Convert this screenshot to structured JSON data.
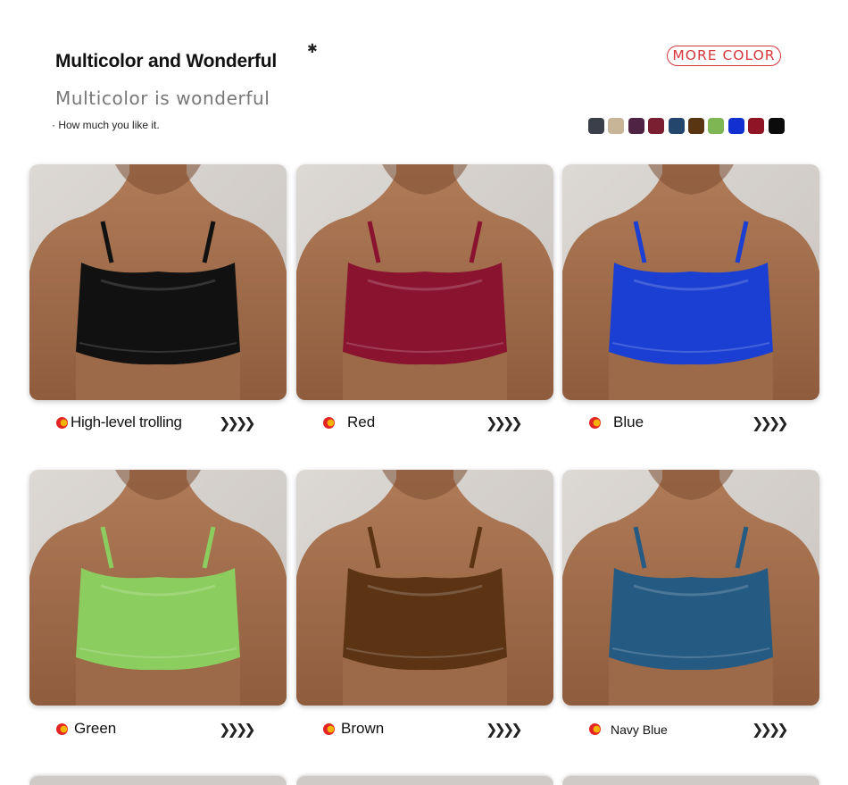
{
  "header": {
    "title": "Multicolor and Wonderful",
    "subtitle": "Multicolor is wonderful",
    "tagline": "· How much you like it.",
    "star_glyph": "✱",
    "more_button": "MORE COLOR"
  },
  "swatches": [
    "#3a3f4a",
    "#c8b597",
    "#4f2343",
    "#7a1f31",
    "#23466d",
    "#5a3512",
    "#7fb654",
    "#1230d0",
    "#8e1426",
    "#0b0b0b"
  ],
  "arrows": "❯❯❯❯",
  "products": [
    {
      "label": "High-level trolling",
      "color": "#111111",
      "icon": "sports-bra-black-photo"
    },
    {
      "label": "Red",
      "color": "#8a1330",
      "icon": "sports-bra-red-photo"
    },
    {
      "label": "Blue",
      "color": "#1a3fd2",
      "icon": "sports-bra-blue-photo"
    },
    {
      "label": "Green",
      "color": "#8ccd5f",
      "icon": "sports-bra-green-photo"
    },
    {
      "label": "Brown",
      "color": "#5c3414",
      "icon": "sports-bra-brown-photo"
    },
    {
      "label": "Navy Blue",
      "color": "#255a82",
      "icon": "sports-bra-navy-photo"
    }
  ]
}
